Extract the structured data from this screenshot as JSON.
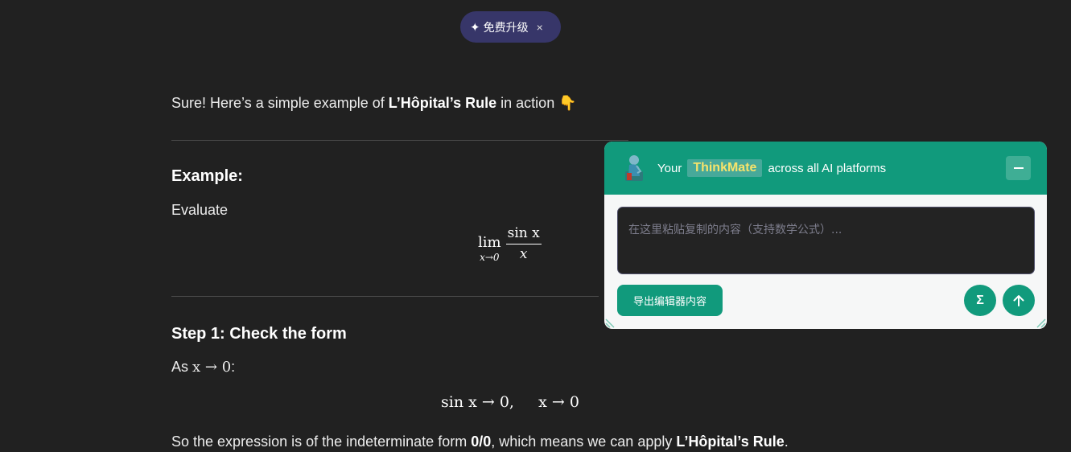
{
  "upgrade": {
    "icon": "sparkle-icon",
    "label": "免费升级",
    "close": "×"
  },
  "chat": {
    "intro": {
      "pre": "Sure! Here’s a simple example of ",
      "bold": "L’Hôpital’s Rule",
      "post": " in action ",
      "emoji": "👇"
    },
    "example_heading": "Example:",
    "evaluate": "Evaluate",
    "limit": {
      "op": "lim",
      "sub": "x→0",
      "num": "sin x",
      "den": "x"
    },
    "step1_heading": "Step 1: Check the form",
    "as_text": "As ",
    "as_math": "x → 0",
    "as_colon": ":",
    "eq1": "sin x → 0,     x → 0",
    "conclusion": {
      "pre": "So the expression is of the indeterminate form ",
      "bold1": "0/0",
      "mid": ", which means we can apply ",
      "bold2": "L’Hôpital’s Rule",
      "post": "."
    }
  },
  "thinkmate": {
    "title_pre": "Your",
    "brand": "ThinkMate",
    "title_post": "across all AI platforms",
    "input_placeholder": "在这里粘贴复制的内容（支持数学公式）...",
    "export_label": "导出编辑器内容",
    "sigma_label": "Σ",
    "colors": {
      "header": "#119a7c",
      "brand_text": "#f7e36b",
      "panel_bg": "#f6f7f7"
    }
  }
}
